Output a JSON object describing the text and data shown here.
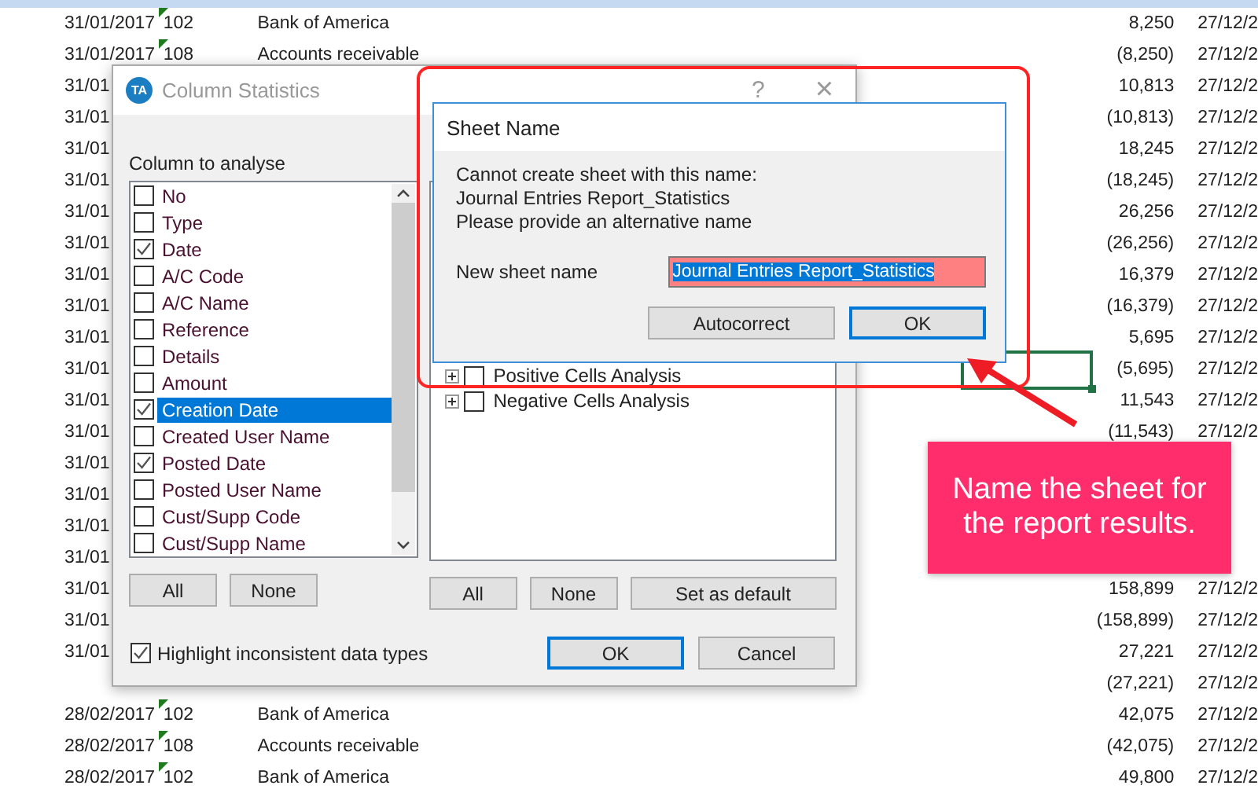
{
  "sheet": {
    "rows": [
      {
        "date": "31/01/2017",
        "code": "102",
        "name": "Bank of America",
        "amount": "8,250",
        "date_2": "27/12/2",
        "flagged": true
      },
      {
        "date": "31/01/2017",
        "code": "108",
        "name": "Accounts receivable",
        "amount": "(8,250)",
        "date_2": "27/12/2",
        "flagged": true
      },
      {
        "date": "31/01",
        "amount": "10,813",
        "date_2": "27/12/2",
        "flagged": false
      },
      {
        "date": "31/01",
        "amount": "(10,813)",
        "date_2": "27/12/2",
        "flagged": false
      },
      {
        "date": "31/01",
        "amount": "18,245",
        "date_2": "27/12/2",
        "flagged": false
      },
      {
        "date": "31/01",
        "amount": "(18,245)",
        "date_2": "27/12/2",
        "flagged": false
      },
      {
        "date": "31/01",
        "amount": "26,256",
        "date_2": "27/12/2",
        "flagged": false
      },
      {
        "date": "31/01",
        "amount": "(26,256)",
        "date_2": "27/12/2",
        "flagged": false
      },
      {
        "date": "31/01",
        "amount": "16,379",
        "date_2": "27/12/2",
        "flagged": false
      },
      {
        "date": "31/01",
        "amount": "(16,379)",
        "date_2": "27/12/2",
        "flagged": false
      },
      {
        "date": "31/01",
        "amount": "5,695",
        "date_2": "27/12/2",
        "flagged": false
      },
      {
        "date": "31/01",
        "amount": "(5,695)",
        "date_2": "27/12/2",
        "flagged": false
      },
      {
        "date": "31/01",
        "amount": "11,543",
        "date_2": "27/12/2",
        "flagged": false
      },
      {
        "date": "31/01",
        "amount": "(11,543)",
        "date_2": "27/12/2",
        "flagged": false
      },
      {
        "date": "31/01",
        "flagged": false
      },
      {
        "date": "31/01",
        "flagged": false
      },
      {
        "date": "31/01",
        "flagged": false
      },
      {
        "date": "31/01",
        "flagged": false
      },
      {
        "date": "31/01",
        "amount": "158,899",
        "date_2": "27/12/2",
        "flagged": false
      },
      {
        "date": "31/01",
        "amount": "(158,899)",
        "date_2": "27/12/2",
        "flagged": false
      },
      {
        "date": "31/01",
        "amount": "27,221",
        "date_2": "27/12/2",
        "flagged": false
      },
      {
        "amount": "(27,221)",
        "date_2": "27/12/2",
        "flagged": false
      },
      {
        "date": "28/02/2017",
        "code": "102",
        "name": "Bank of America",
        "amount": "42,075",
        "date_2": "27/12/2",
        "flagged": true
      },
      {
        "date": "28/02/2017",
        "code": "108",
        "name": "Accounts receivable",
        "amount": "(42,075)",
        "date_2": "27/12/2",
        "flagged": true
      },
      {
        "date": "28/02/2017",
        "code": "102",
        "name": "Bank of America",
        "amount": "49,800",
        "date_2": "27/12/2",
        "flagged": true
      }
    ]
  },
  "column_statistics": {
    "logo": "TA",
    "title": "Column Statistics",
    "help": "?",
    "close": "×",
    "column_label": "Column to analyse",
    "columns": [
      {
        "label": "No",
        "checked": false,
        "selected": false
      },
      {
        "label": "Type",
        "checked": false,
        "selected": false
      },
      {
        "label": "Date",
        "checked": true,
        "selected": false
      },
      {
        "label": "A/C Code",
        "checked": false,
        "selected": false
      },
      {
        "label": "A/C Name",
        "checked": false,
        "selected": false
      },
      {
        "label": "Reference",
        "checked": false,
        "selected": false
      },
      {
        "label": "Details",
        "checked": false,
        "selected": false
      },
      {
        "label": "Amount",
        "checked": false,
        "selected": false
      },
      {
        "label": "Creation Date",
        "checked": true,
        "selected": true
      },
      {
        "label": "Created User Name",
        "checked": false,
        "selected": false
      },
      {
        "label": "Posted Date",
        "checked": true,
        "selected": false
      },
      {
        "label": "Posted User Name",
        "checked": false,
        "selected": false
      },
      {
        "label": "Cust/Supp Code",
        "checked": false,
        "selected": false
      },
      {
        "label": "Cust/Supp Name",
        "checked": false,
        "selected": false
      }
    ],
    "left_buttons": [
      "All",
      "None"
    ],
    "analyses": [
      {
        "label": "Positive Cells Analysis",
        "checked": false
      },
      {
        "label": "Negative Cells Analysis",
        "checked": false
      }
    ],
    "right_buttons": [
      "All",
      "None",
      "Set as default"
    ],
    "highlight": {
      "label": "Highlight inconsistent data types",
      "checked": true
    },
    "ok": "OK",
    "cancel": "Cancel"
  },
  "sheet_name_dialog": {
    "title": "Sheet Name",
    "message": [
      "Cannot create sheet with this name:",
      "Journal Entries Report_Statistics",
      "Please provide an alternative name"
    ],
    "field_label": "New sheet name",
    "value": "Journal Entries Report_Statistics",
    "invalid": true,
    "buttons": [
      {
        "label": "Autocorrect",
        "focused": false
      },
      {
        "label": "OK",
        "focused": true
      }
    ]
  },
  "callout": {
    "text": "Name the sheet for the report results."
  }
}
